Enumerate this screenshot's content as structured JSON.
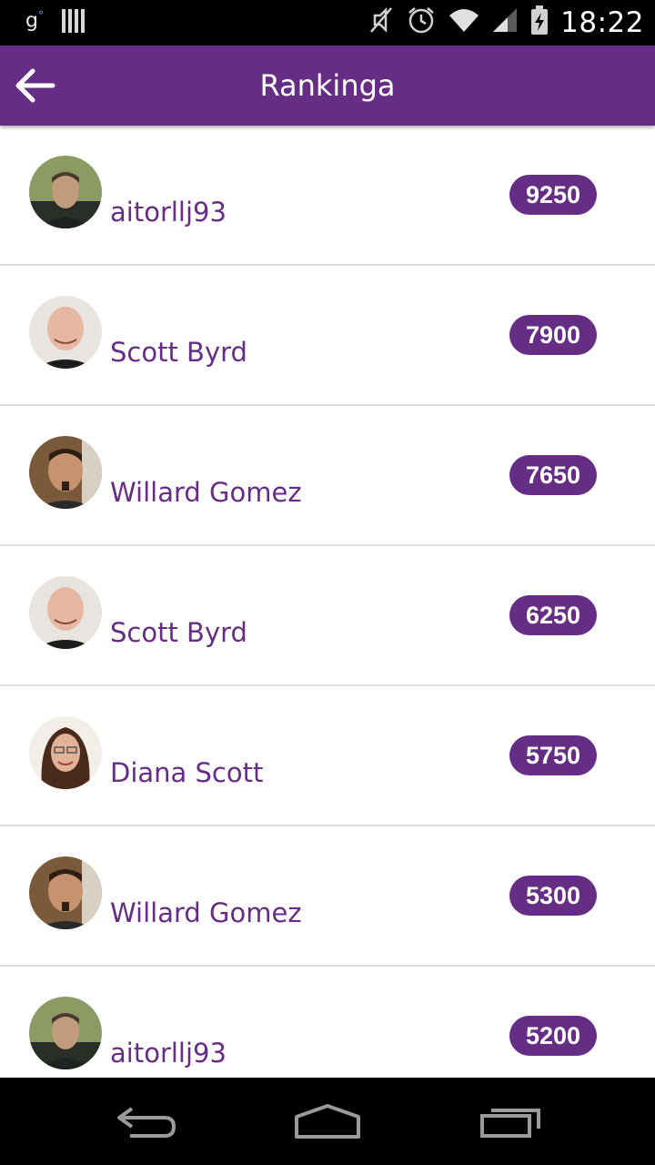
{
  "status_bar": {
    "carrier_glyph": "g",
    "time": "18:22",
    "icons": [
      "signal-bars-icon",
      "mute-icon",
      "alarm-icon",
      "wifi-icon",
      "cell-signal-icon",
      "battery-charging-icon"
    ]
  },
  "app_bar": {
    "title": "Rankinga",
    "back_icon": "arrow-left-icon"
  },
  "colors": {
    "accent": "#662d84",
    "divider": "#dedede",
    "status_bar": "#000000"
  },
  "ranking": [
    {
      "name": "aitorllj93",
      "score": "9250",
      "avatar": "avatar-aitorllj93"
    },
    {
      "name": "Scott Byrd",
      "score": "7900",
      "avatar": "avatar-scott-byrd"
    },
    {
      "name": "Willard Gomez",
      "score": "7650",
      "avatar": "avatar-willard-gomez"
    },
    {
      "name": "Scott Byrd",
      "score": "6250",
      "avatar": "avatar-scott-byrd"
    },
    {
      "name": "Diana Scott",
      "score": "5750",
      "avatar": "avatar-diana-scott"
    },
    {
      "name": "Willard Gomez",
      "score": "5300",
      "avatar": "avatar-willard-gomez"
    },
    {
      "name": "aitorllj93",
      "score": "5200",
      "avatar": "avatar-aitorllj93"
    }
  ],
  "nav_bar": {
    "buttons": [
      "back-nav-icon",
      "home-nav-icon",
      "recents-nav-icon"
    ]
  }
}
